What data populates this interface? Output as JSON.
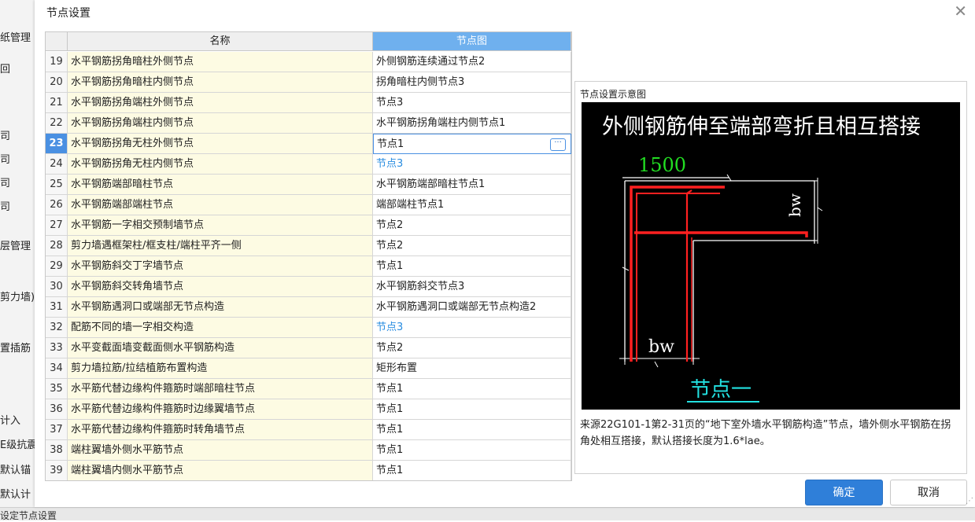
{
  "background": {
    "sidebar_items": [
      "纸管理",
      "回",
      "司",
      "司",
      "司",
      "司",
      "层管理",
      "剪力墙)",
      "置插筋",
      "计入",
      "E级抗震",
      "默认锚",
      "默认计"
    ],
    "status_text": "设定节点设置"
  },
  "dialog": {
    "title": "节点设置",
    "close_glyph": "✕",
    "columns": {
      "name": "名称",
      "node": "节点图"
    },
    "selected_row": 23,
    "rows": [
      {
        "num": "19",
        "name": "水平钢筋拐角暗柱外侧节点",
        "node": "外侧钢筋连续通过节点2",
        "style": ""
      },
      {
        "num": "20",
        "name": "水平钢筋拐角暗柱内侧节点",
        "node": "拐角暗柱内侧节点3",
        "style": ""
      },
      {
        "num": "21",
        "name": "水平钢筋拐角端柱外侧节点",
        "node": "节点3",
        "style": ""
      },
      {
        "num": "22",
        "name": "水平钢筋拐角端柱内侧节点",
        "node": "水平钢筋拐角端柱内侧节点1",
        "style": ""
      },
      {
        "num": "23",
        "name": "水平钢筋拐角无柱外侧节点",
        "node": "节点1",
        "style": "active"
      },
      {
        "num": "24",
        "name": "水平钢筋拐角无柱内侧节点",
        "node": "节点3",
        "style": "link"
      },
      {
        "num": "25",
        "name": "水平钢筋端部暗柱节点",
        "node": "水平钢筋端部暗柱节点1",
        "style": ""
      },
      {
        "num": "26",
        "name": "水平钢筋端部端柱节点",
        "node": "端部端柱节点1",
        "style": ""
      },
      {
        "num": "27",
        "name": "水平钢筋一字相交预制墙节点",
        "node": "节点2",
        "style": ""
      },
      {
        "num": "28",
        "name": "剪力墙遇框架柱/框支柱/端柱平齐一侧",
        "node": "节点2",
        "style": ""
      },
      {
        "num": "29",
        "name": "水平钢筋斜交丁字墙节点",
        "node": "节点1",
        "style": ""
      },
      {
        "num": "30",
        "name": "水平钢筋斜交转角墙节点",
        "node": "水平钢筋斜交节点3",
        "style": ""
      },
      {
        "num": "31",
        "name": "水平钢筋遇洞口或端部无节点构造",
        "node": "水平钢筋遇洞口或端部无节点构造2",
        "style": ""
      },
      {
        "num": "32",
        "name": "配筋不同的墙一字相交构造",
        "node": "节点3",
        "style": "link"
      },
      {
        "num": "33",
        "name": "水平变截面墙变截面侧水平钢筋构造",
        "node": "节点2",
        "style": ""
      },
      {
        "num": "34",
        "name": "剪力墙拉筋/拉结植筋布置构造",
        "node": "矩形布置",
        "style": ""
      },
      {
        "num": "35",
        "name": "水平筋代替边缘构件箍筋时端部暗柱节点",
        "node": "节点1",
        "style": ""
      },
      {
        "num": "36",
        "name": "水平筋代替边缘构件箍筋时边缘翼墙节点",
        "node": "节点1",
        "style": ""
      },
      {
        "num": "37",
        "name": "水平筋代替边缘构件箍筋时转角墙节点",
        "node": "节点1",
        "style": ""
      },
      {
        "num": "38",
        "name": "端柱翼墙外侧水平筋节点",
        "node": "节点1",
        "style": ""
      },
      {
        "num": "39",
        "name": "端柱翼墙内侧水平筋节点",
        "node": "节点1",
        "style": ""
      }
    ],
    "preview": {
      "title": "节点设置示意图",
      "image": {
        "heading": "外侧钢筋伸至端部弯折且相互搭接",
        "dim_top": "1500",
        "dim_right": "bw",
        "dim_bottom": "bw",
        "caption": "节点一",
        "colors": {
          "heading": "#ffffff",
          "dim_top": "#22dd22",
          "rebar": "#ff2020",
          "lines": "#ffffff",
          "caption": "#22e0e0"
        }
      },
      "description": "来源22G101-1第2-31页的“地下室外墙水平钢筋构造”节点，墙外侧水平钢筋在拐角处相互搭接，默认搭接长度为1.6*lae。"
    },
    "buttons": {
      "ok": "确定",
      "cancel": "取消"
    },
    "colors": {
      "accent": "#2f7fd9",
      "header_active": "#6fb0ee",
      "name_cell_bg": "#fdfbe3",
      "link": "#2a8de0"
    }
  }
}
